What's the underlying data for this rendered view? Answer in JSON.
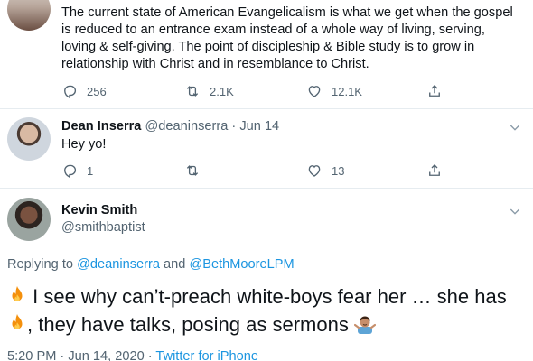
{
  "top_tweet": {
    "text": "The current state of American Evangelicalism is what we get when the gospel is reduced to an entrance exam instead of a whole way of living, serving, loving & self-giving. The point of discipleship & Bible study is to grow in relationship with Christ and in resemblance to Christ.",
    "actions": {
      "reply_icon": "reply-icon",
      "reply_count": "256",
      "retweet_icon": "retweet-icon",
      "retweet_count": "2.1K",
      "like_icon": "heart-icon",
      "like_count": "12.1K",
      "share_icon": "share-icon"
    }
  },
  "reply_tweet": {
    "name": "Dean Inserra",
    "handle": "@deaninserra",
    "separator": " · ",
    "date": "Jun 14",
    "text": "Hey yo!",
    "actions": {
      "reply_count": "1",
      "retweet_count": "",
      "like_count": "13"
    }
  },
  "main_tweet": {
    "name": "Kevin Smith",
    "handle": "@smithbaptist",
    "replying_prefix": "Replying to ",
    "replying_user1": "@deaninserra",
    "replying_and": " and ",
    "replying_user2": "@BethMooreLPM",
    "text_part1": " I see why can’t-preach white-boys fear her … she has ",
    "text_part2": ", they have talks, posing as sermons ",
    "emoji_fire": "fire-emoji",
    "emoji_shrug": "man-shrugging-emoji",
    "time": "5:20 PM · Jun 14, 2020 · ",
    "source": "Twitter for iPhone"
  },
  "colors": {
    "text": "#0f1419",
    "secondary": "#536471",
    "link": "#1b95e0",
    "divider": "#e6ecf0"
  }
}
